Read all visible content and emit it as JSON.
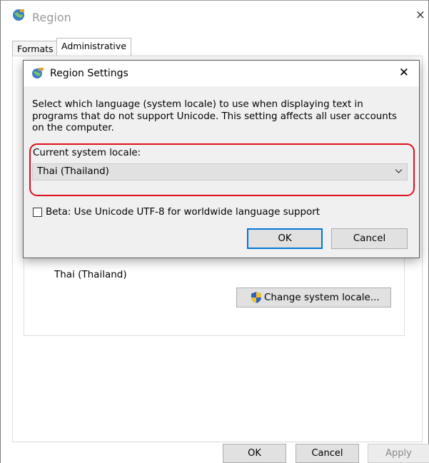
{
  "window": {
    "title": "Region",
    "close_glyph": "×"
  },
  "tabs": [
    {
      "label": "Formats"
    },
    {
      "label": "Administrative"
    }
  ],
  "admin_panel": {
    "current_locale_value": "Thai (Thailand)",
    "change_button_label": "Change system locale..."
  },
  "footer": {
    "ok_label": "OK",
    "cancel_label": "Cancel",
    "apply_label": "Apply"
  },
  "dialog": {
    "title": "Region Settings",
    "close_glyph": "✕",
    "description": "Select which language (system locale) to use when displaying text in programs that do not support Unicode. This setting affects all user accounts on the computer.",
    "locale_label": "Current system locale:",
    "locale_value": "Thai (Thailand)",
    "beta_label": "Beta: Use Unicode UTF-8 for worldwide language support",
    "beta_checked": false,
    "ok_label": "OK",
    "cancel_label": "Cancel"
  },
  "colors": {
    "highlight": "#e0101a",
    "default_button_border": "#0078d7"
  },
  "icons": {
    "window": "globe-icon",
    "shield": "shield-icon",
    "dropdown": "chevron-down-icon"
  }
}
